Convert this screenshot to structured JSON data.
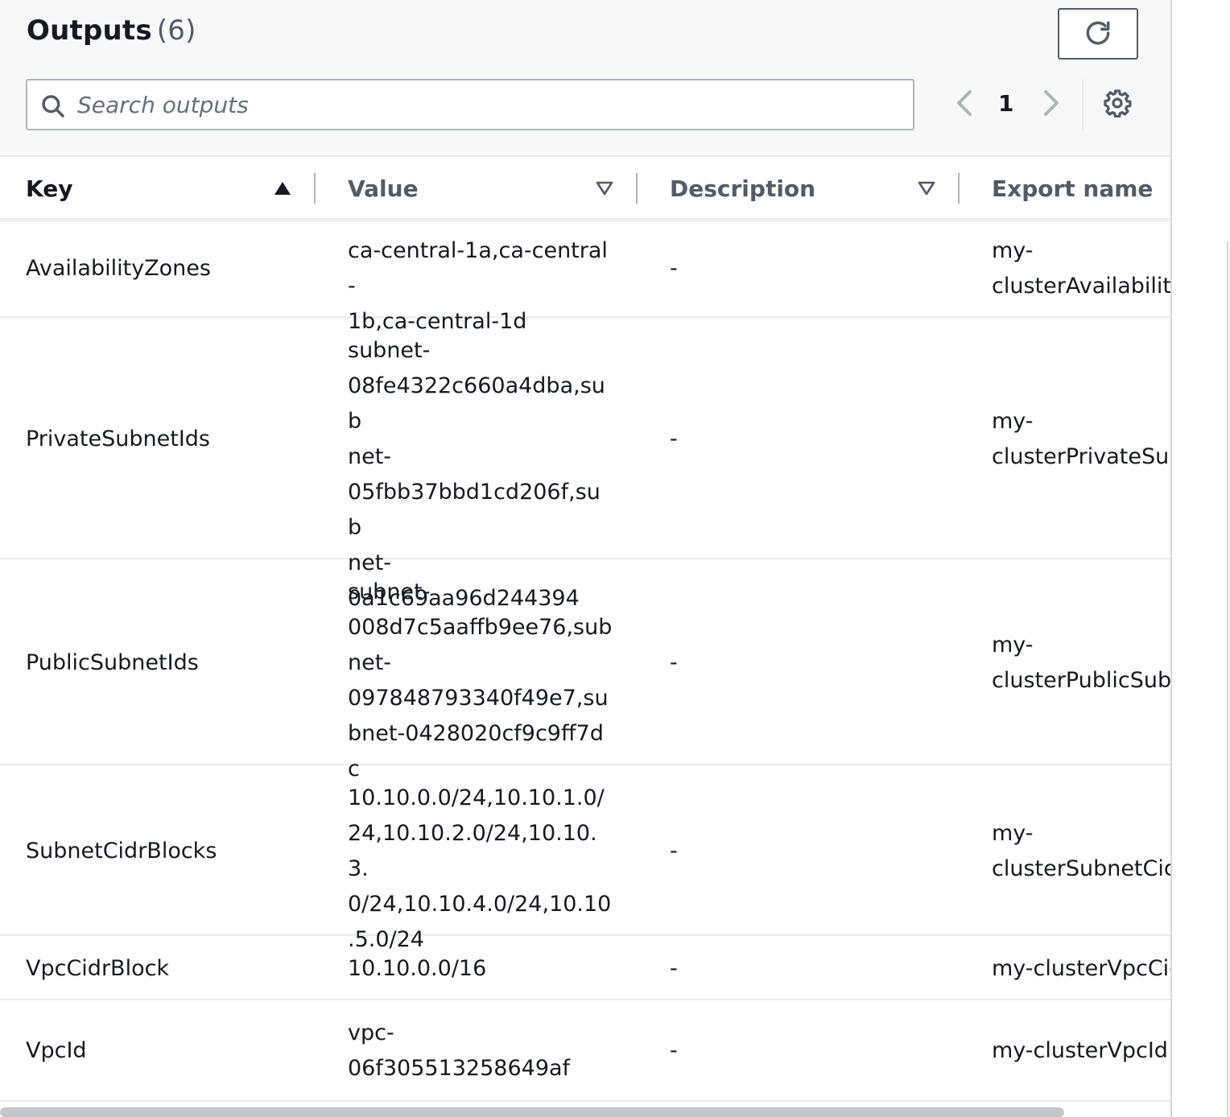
{
  "header": {
    "title": "Outputs",
    "count": "(6)"
  },
  "search": {
    "placeholder": "Search outputs",
    "value": ""
  },
  "pagination": {
    "current_page": "1"
  },
  "icons": {
    "refresh": "refresh-icon",
    "search": "search-icon",
    "prev": "chevron-left-icon",
    "next": "chevron-right-icon",
    "settings": "gear-icon",
    "sort_asc": "caret-up-filled-icon",
    "sort_none": "caret-down-outline-icon"
  },
  "columns": {
    "key": "Key",
    "value": "Value",
    "description": "Description",
    "export_name": "Export name"
  },
  "rows": [
    {
      "key": "AvailabilityZones",
      "value": [
        "ca-central-1a,ca-central-",
        "1b,ca-central-1d"
      ],
      "description": "-",
      "export_name": [
        "my-",
        "clusterAvailabilityZones"
      ]
    },
    {
      "key": "PrivateSubnetIds",
      "value": [
        "subnet-",
        "08fe4322c660a4dba,sub",
        "net-",
        "05fbb37bbd1cd206f,sub",
        "net-",
        "0a1c69aa96d244394"
      ],
      "description": "-",
      "export_name": [
        "my-",
        "clusterPrivateSubnetIds"
      ]
    },
    {
      "key": "PublicSubnetIds",
      "value": [
        "subnet-",
        "008d7c5aaffb9ee76,sub",
        "net-",
        "097848793340f49e7,su",
        "bnet-0428020cf9c9ff7dc"
      ],
      "description": "-",
      "export_name": [
        "my-",
        "clusterPublicSubnetIds"
      ]
    },
    {
      "key": "SubnetCidrBlocks",
      "value": [
        "10.10.0.0/24,10.10.1.0/",
        "24,10.10.2.0/24,10.10.3.",
        "0/24,10.10.4.0/24,10.10",
        ".5.0/24"
      ],
      "description": "-",
      "export_name": [
        "my-",
        "clusterSubnetCidrBlocks"
      ]
    },
    {
      "key": "VpcCidrBlock",
      "value": [
        "10.10.0.0/16"
      ],
      "description": "-",
      "export_name": [
        "my-clusterVpcCidrBlock"
      ]
    },
    {
      "key": "VpcId",
      "value": [
        "vpc-",
        "06f305513258649af"
      ],
      "description": "-",
      "export_name": [
        "my-clusterVpcId"
      ]
    }
  ]
}
